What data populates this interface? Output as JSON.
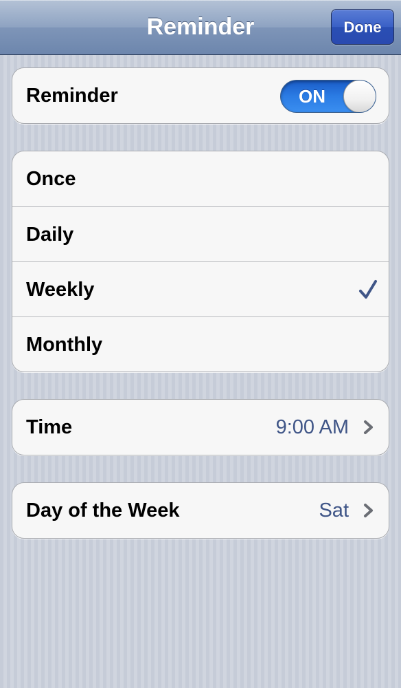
{
  "navbar": {
    "title": "Reminder",
    "done_label": "Done"
  },
  "reminder_toggle": {
    "label": "Reminder",
    "state": "ON"
  },
  "frequency": {
    "options": [
      "Once",
      "Daily",
      "Weekly",
      "Monthly"
    ],
    "selected": "Weekly"
  },
  "time": {
    "label": "Time",
    "value": "9:00 AM"
  },
  "day_of_week": {
    "label": "Day of the Week",
    "value": "Sat"
  },
  "icons": {
    "checkmark": "checkmark-icon",
    "chevron": "chevron-right-icon"
  },
  "colors": {
    "navbar": "#8ea3c2",
    "done_button": "#3a60c6",
    "toggle_on": "#2b7ce4",
    "value_text": "#3f5587",
    "checkmark": "#3f5587"
  }
}
